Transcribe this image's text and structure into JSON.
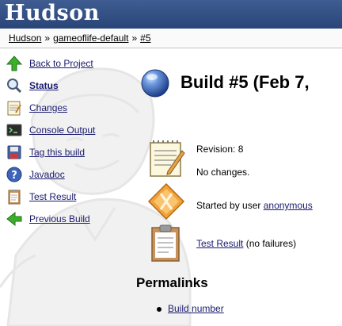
{
  "header": {
    "logo": "Hudson"
  },
  "breadcrumb": {
    "items": [
      "Hudson",
      "gameoflife-default",
      "#5"
    ],
    "separator": "»"
  },
  "sidebar": {
    "items": [
      {
        "label": "Back to Project",
        "icon": "up-arrow-icon",
        "bold": false
      },
      {
        "label": "Status",
        "icon": "magnifier-icon",
        "bold": true
      },
      {
        "label": "Changes",
        "icon": "notepad-icon",
        "bold": false
      },
      {
        "label": "Console Output",
        "icon": "terminal-icon",
        "bold": false
      },
      {
        "label": "Tag this build",
        "icon": "save-icon",
        "bold": false
      },
      {
        "label": "Javadoc",
        "icon": "help-icon",
        "bold": false
      },
      {
        "label": "Test Result",
        "icon": "clipboard-icon",
        "bold": false
      },
      {
        "label": "Previous Build",
        "icon": "left-arrow-icon",
        "bold": false
      }
    ]
  },
  "main": {
    "title": "Build #5 (Feb 7,",
    "status_color": "#3a6fc6",
    "revision_label": "Revision: 8",
    "changes_text": "No changes.",
    "started_prefix": "Started by user",
    "started_user": "anonymous",
    "test_result_link": "Test Result",
    "test_result_suffix": "(no failures)",
    "permalinks_heading": "Permalinks",
    "permalinks": [
      "Build number"
    ]
  }
}
